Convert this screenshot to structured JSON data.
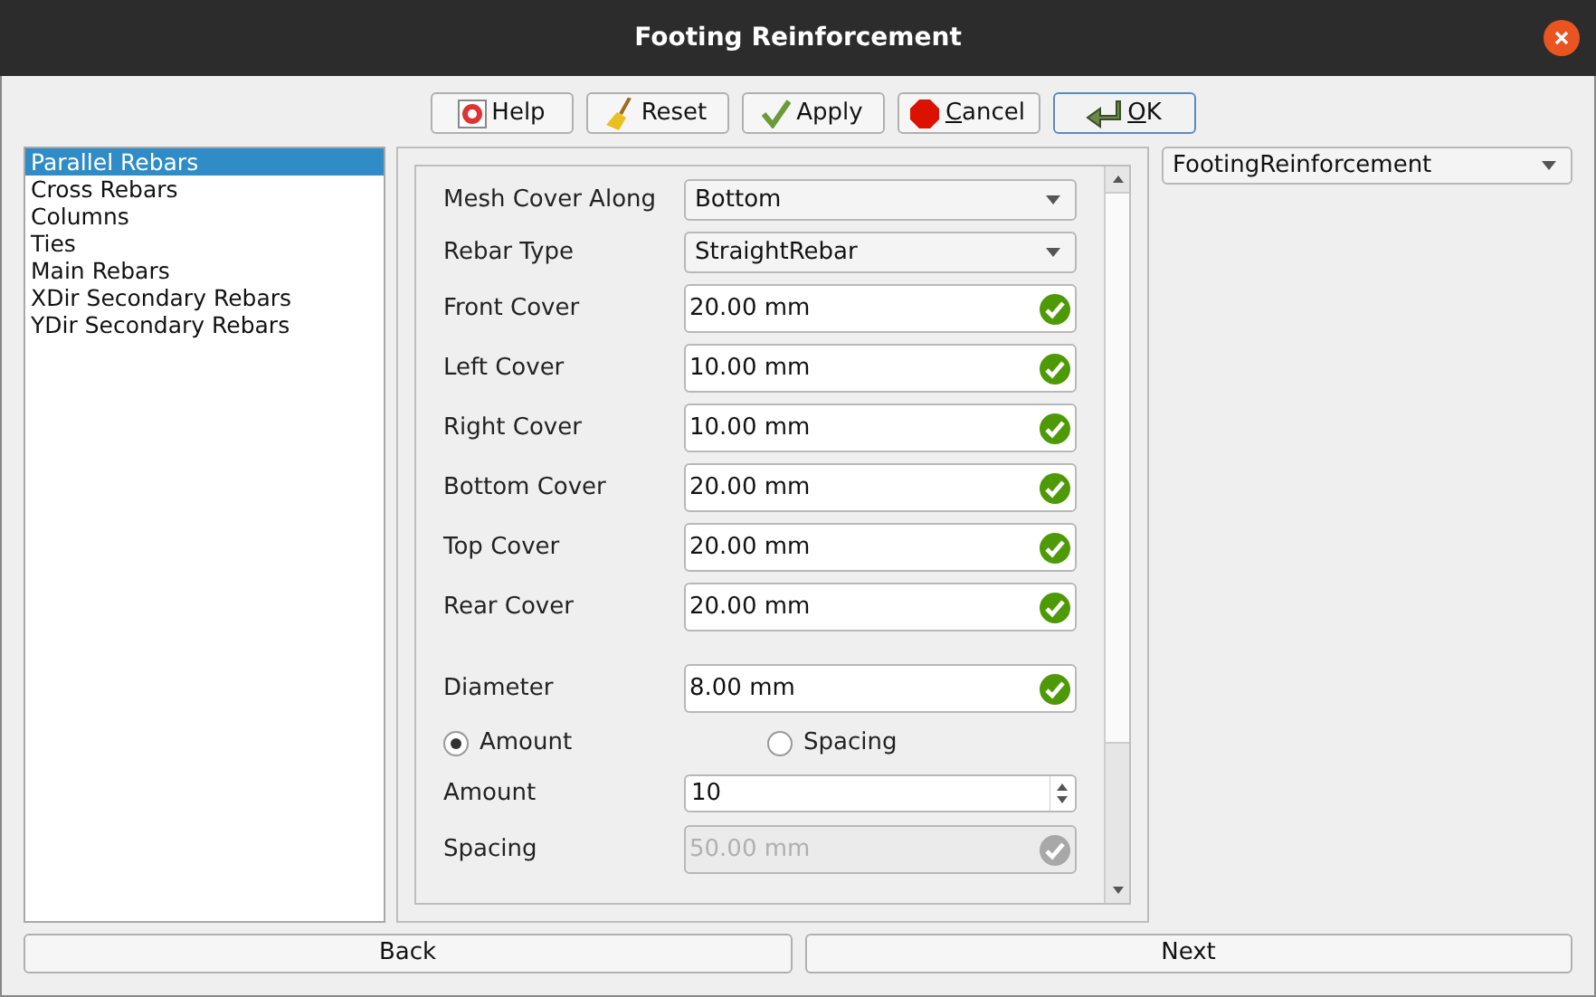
{
  "window": {
    "title": "Footing Reinforcement"
  },
  "toolbar": [
    {
      "label": "Help",
      "mnemonic": false,
      "default": false
    },
    {
      "label": "Reset",
      "mnemonic": false,
      "default": false
    },
    {
      "label": "Apply",
      "mnemonic": false,
      "default": false
    },
    {
      "label": "Cancel",
      "mnemonic": true,
      "default": false
    },
    {
      "label": "OK",
      "mnemonic": true,
      "default": true
    }
  ],
  "sidebar": {
    "items": [
      {
        "label": "Parallel Rebars",
        "selected": true
      },
      {
        "label": "Cross Rebars",
        "selected": false
      },
      {
        "label": "Columns",
        "selected": false
      },
      {
        "label": "Ties",
        "selected": false
      },
      {
        "label": "Main Rebars",
        "selected": false
      },
      {
        "label": "XDir Secondary Rebars",
        "selected": false
      },
      {
        "label": "YDir Secondary Rebars",
        "selected": false
      }
    ]
  },
  "form": [
    {
      "kind": "combo",
      "label": "Mesh Cover Along",
      "value": "Bottom"
    },
    {
      "kind": "combo",
      "label": "Rebar Type",
      "value": "StraightRebar"
    },
    {
      "kind": "length",
      "label": "Front Cover",
      "value": "20.00 mm",
      "disabled": false
    },
    {
      "kind": "length",
      "label": "Left Cover",
      "value": "10.00 mm",
      "disabled": false
    },
    {
      "kind": "length",
      "label": "Right Cover",
      "value": "10.00 mm",
      "disabled": false
    },
    {
      "kind": "length",
      "label": "Bottom Cover",
      "value": "20.00 mm",
      "disabled": false
    },
    {
      "kind": "length",
      "label": "Top Cover",
      "value": "20.00 mm",
      "disabled": false
    },
    {
      "kind": "length",
      "label": "Rear Cover",
      "value": "20.00 mm",
      "disabled": false
    },
    {
      "kind": "spacer"
    },
    {
      "kind": "length",
      "label": "Diameter",
      "value": "8.00 mm",
      "disabled": false
    },
    {
      "kind": "radios",
      "options": [
        {
          "label": "Amount",
          "selected": true
        },
        {
          "label": "Spacing",
          "selected": false
        }
      ]
    },
    {
      "kind": "spin",
      "label": "Amount",
      "value": "10"
    },
    {
      "kind": "length",
      "label": "Spacing",
      "value": "50.00 mm",
      "disabled": true
    }
  ],
  "preset": {
    "value": "FootingReinforcement"
  },
  "footer": [
    {
      "label": "Back"
    },
    {
      "label": "Next"
    }
  ]
}
